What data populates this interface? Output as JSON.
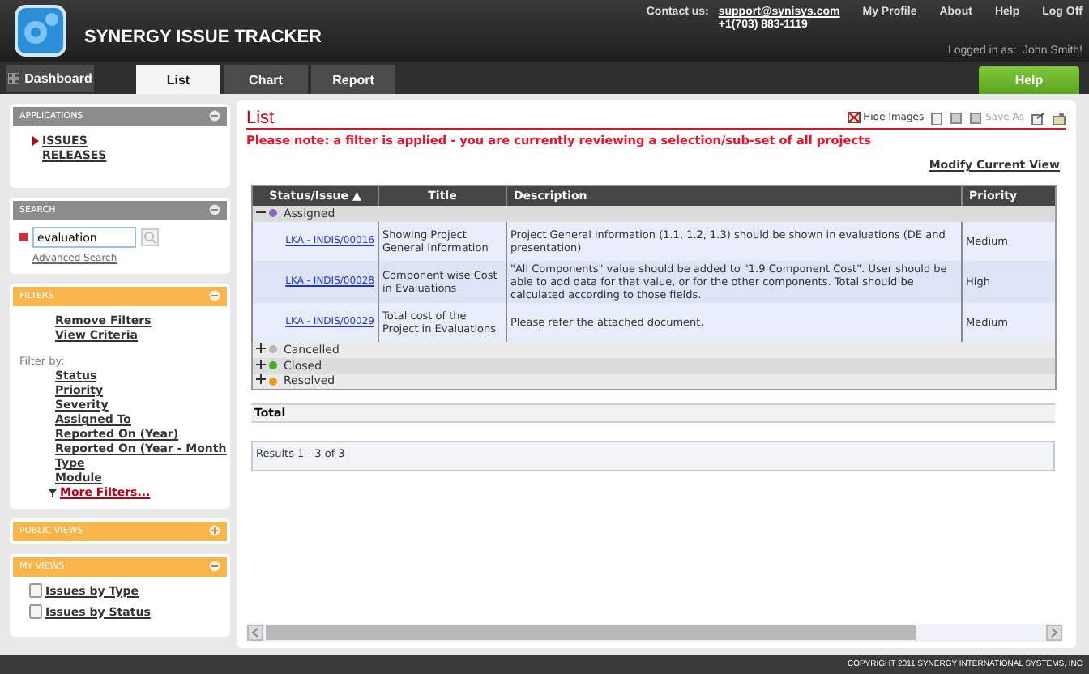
{
  "header": {
    "app_title": "SYNERGY ISSUE TRACKER",
    "contact_label": "Contact us:",
    "contact_email": "support@synisys.com",
    "contact_phone": "+1(703) 883-1119",
    "nav_links": [
      "My Profile",
      "About",
      "Help",
      "Log Off"
    ],
    "logged_in_label": "Logged in as:",
    "user_name": "John Smith!"
  },
  "tabs": [
    {
      "label": "Dashboard",
      "kind": "home",
      "selected": false
    },
    {
      "label": "List",
      "kind": "tab",
      "selected": true
    },
    {
      "label": "Chart",
      "kind": "tab",
      "selected": false
    },
    {
      "label": "Report",
      "kind": "tab",
      "selected": false
    }
  ],
  "help_button": "Help",
  "sidebar": {
    "panels": [
      {
        "kind": "applications",
        "title": "APPLICATIONS",
        "color": "#8c8c8c",
        "expanded": true,
        "items": [
          {
            "label": "ISSUES",
            "selected": true
          },
          {
            "label": "RELEASES",
            "selected": false
          }
        ]
      },
      {
        "kind": "search",
        "title": "SEARCH",
        "color": "#8c8c8c",
        "expanded": true,
        "value": "evaluation",
        "link": "Advanced Search"
      },
      {
        "kind": "filters",
        "title": "FILTERS",
        "color": "#f7b54a",
        "expanded": true,
        "actions": [
          "Remove Filters",
          "View Criteria"
        ],
        "filter_by": "Filter by:",
        "filters": [
          "Status",
          "Priority",
          "Severity",
          "Assigned To",
          "Reported On (Year)",
          "Reported On (Year - Month",
          "Type",
          "Module"
        ],
        "more": "More Filters..."
      },
      {
        "kind": "views",
        "title": "PUBLIC VIEWS",
        "color": "#f7b54a",
        "expanded": false
      },
      {
        "kind": "views",
        "title": "MY VIEWS",
        "color": "#f7b54a",
        "expanded": true,
        "items": [
          "Issues by Type",
          "Issues by Status"
        ]
      }
    ]
  },
  "main": {
    "title": "List",
    "toolbar": {
      "hide_images": "Hide Images",
      "save_as": "Save As"
    },
    "notice": "Please note: a filter is applied - you are currently reviewing a selection/sub-set of all projects",
    "modify_link": "Modify Current View",
    "columns": [
      "Status/Issue ▲",
      "Title",
      "Description",
      "Priority"
    ],
    "groups": [
      {
        "name": "Assigned",
        "color": "#8b6cc4",
        "expanded": true,
        "rows": [
          {
            "id": "LKA - INDIS/00016",
            "title": "Showing Project General Information",
            "description": "Project General information (1.1, 1.2, 1.3) should be shown in evaluations (DE and presentation)",
            "priority": "Medium"
          },
          {
            "id": "LKA - INDIS/00028",
            "title": "Component wise Cost in Evaluations",
            "description": "\"All Components\" value should be added to \"1.9 Component Cost\". User should be able to add data for that value, or for the other components. Total should be calculated according to those fields.",
            "priority": "High"
          },
          {
            "id": "LKA - INDIS/00029",
            "title": "Total cost of the Project in Evaluations",
            "description": "Please refer the attached document.",
            "priority": "Medium"
          }
        ]
      },
      {
        "name": "Cancelled",
        "color": "#b8b8b8",
        "expanded": false
      },
      {
        "name": "Closed",
        "color": "#3fae1f",
        "expanded": false
      },
      {
        "name": "Resolved",
        "color": "#ec9a1c",
        "expanded": false
      }
    ],
    "total_label": "Total",
    "results": "Results 1 - 3 of 3"
  },
  "footer": "COPYRIGHT 2011 SYNERGY INTERNATIONAL SYSTEMS, INC"
}
